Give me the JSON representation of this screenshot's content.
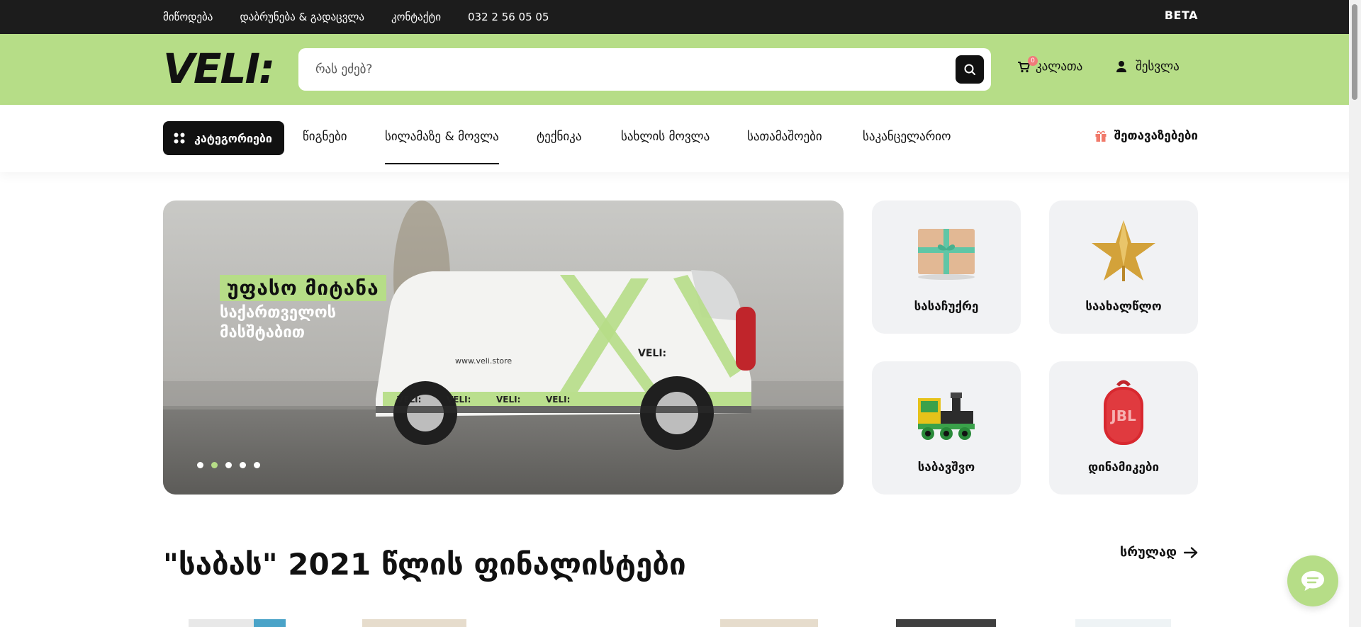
{
  "topbar": {
    "links": [
      "მიწოდება",
      "დაბრუნება & გადაცვლა",
      "კონტაქტი",
      "032 2 56 05 05"
    ],
    "beta": "BETA"
  },
  "header": {
    "logo_text": "VELI:",
    "search_placeholder": "რას ეძებ?",
    "cart_label": "კალათა",
    "cart_count": "0",
    "login_label": "შესვლა"
  },
  "nav": {
    "categories_button": "კატეგორიები",
    "items": [
      "წიგნები",
      "სილამაზე & მოვლა",
      "ტექნიკა",
      "სახლის მოვლა",
      "სათამაშოები",
      "საკანცელარიო"
    ],
    "active_index": 1,
    "offers_label": "შეთავაზებები"
  },
  "hero": {
    "headline": "უფასო მიტანა",
    "subline": "საქართველოს მასშტაბით",
    "van_url_text": "www.veli.store",
    "van_tape_text": "VELI:",
    "slide_count": 5,
    "active_slide": 1
  },
  "tiles": [
    {
      "label": "სასაჩუქრე",
      "icon": "gift-box-icon"
    },
    {
      "label": "საახალწლო",
      "icon": "star-ornament-icon"
    },
    {
      "label": "საბავშვო",
      "icon": "toy-train-icon"
    },
    {
      "label": "დინამიკები",
      "icon": "jbl-speaker-icon",
      "brand_text": "JBL"
    }
  ],
  "section": {
    "title": "\"საბას\" 2021 წლის ფინალისტები",
    "see_all": "სრულად"
  },
  "colors": {
    "brand_green": "#b6dd87",
    "topbar_bg": "#1c1c1c",
    "tile_bg": "#f1f2f4"
  }
}
